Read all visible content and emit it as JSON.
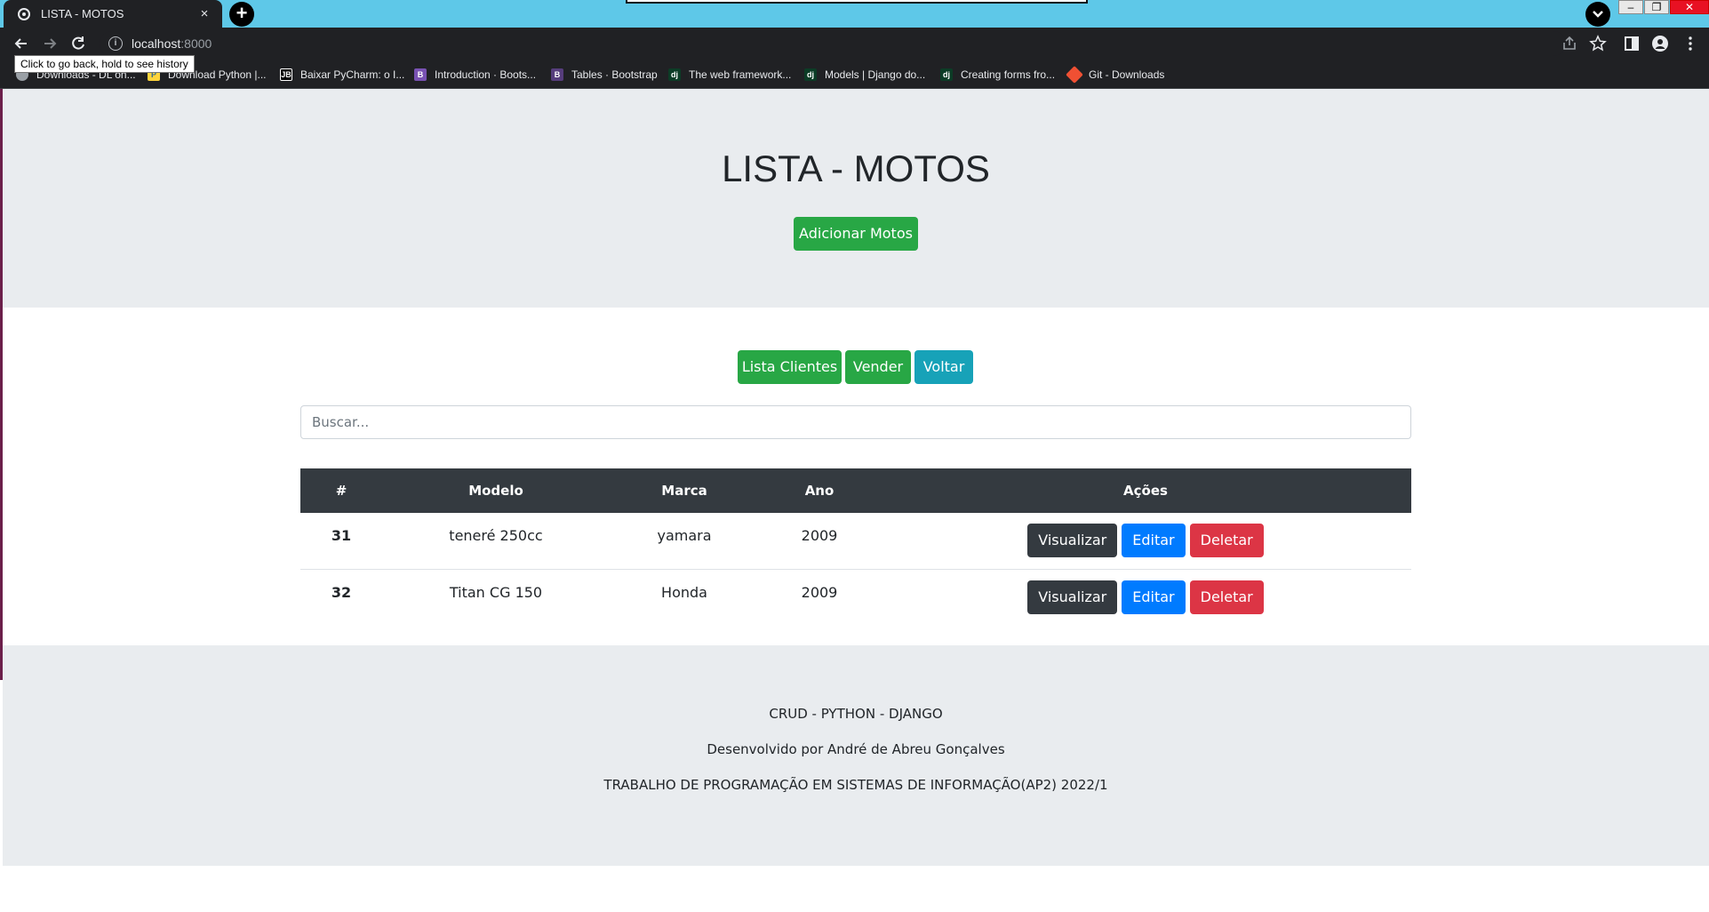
{
  "browser": {
    "tab_title": "LISTA - MOTOS",
    "tab_close": "×",
    "new_tab": "+",
    "url_host": "localhost",
    "url_port": ":8000",
    "tooltip": "Click to go back, hold to see history",
    "bookmarks": [
      {
        "label": "Downloads - DL on...",
        "icon": "folder-icon"
      },
      {
        "label": "Download Python |...",
        "icon": "python-icon"
      },
      {
        "label": "Baixar PyCharm: o I...",
        "icon": "jb-icon"
      },
      {
        "label": "Introduction · Boots...",
        "icon": "bootstrap-icon"
      },
      {
        "label": "Tables · Bootstrap",
        "icon": "bootstrap-icon"
      },
      {
        "label": "The web framework...",
        "icon": "django-icon"
      },
      {
        "label": "Models | Django do...",
        "icon": "django-icon"
      },
      {
        "label": "Creating forms fro...",
        "icon": "django-icon"
      },
      {
        "label": "Git - Downloads",
        "icon": "git-icon"
      }
    ]
  },
  "header": {
    "title": "LISTA - MOTOS",
    "add_button": "Adicionar Motos"
  },
  "nav_buttons": {
    "clients": "Lista Clientes",
    "sell": "Vender",
    "back": "Voltar"
  },
  "search": {
    "placeholder": "Buscar..."
  },
  "table": {
    "columns": [
      "#",
      "Modelo",
      "Marca",
      "Ano",
      "Ações"
    ],
    "rows": [
      {
        "id": "31",
        "modelo": "teneré 250cc",
        "marca": "yamara",
        "ano": "2009"
      },
      {
        "id": "32",
        "modelo": "Titan CG 150",
        "marca": "Honda",
        "ano": "2009"
      }
    ],
    "actions": {
      "view": "Visualizar",
      "edit": "Editar",
      "delete": "Deletar"
    }
  },
  "footer": {
    "line1": "CRUD - PYTHON - DJANGO",
    "line2": "Desenvolvido por André de Abreu Gonçalves",
    "line3": "TRABALHO DE PROGRAMAÇÃO EM SISTEMAS DE INFORMAÇÃO(AP2) 2022/1"
  },
  "colors": {
    "tabstrip": "#5ec8e8",
    "success": "#28a745",
    "info": "#17a2b8",
    "dark": "#343a40",
    "primary": "#007bff",
    "danger": "#dc3545",
    "jumbotron": "#e9ecef"
  }
}
